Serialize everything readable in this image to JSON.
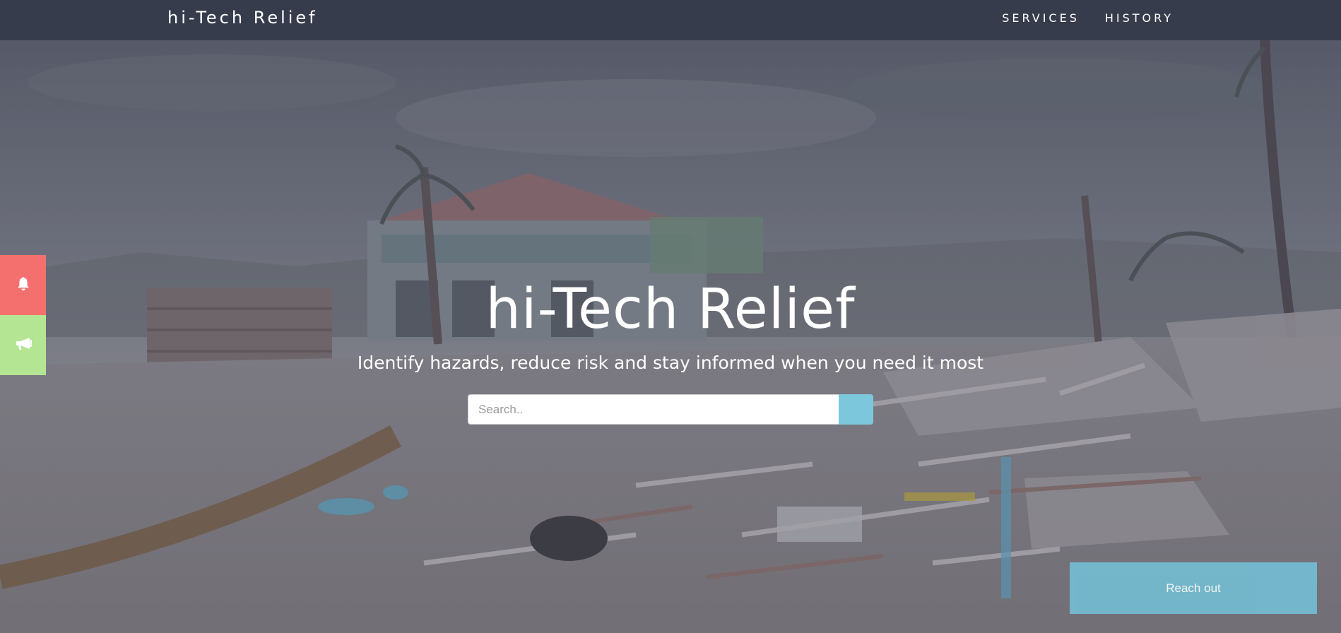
{
  "navbar": {
    "brand": "hi-Tech Relief",
    "links": [
      {
        "label": "SERVICES"
      },
      {
        "label": "HISTORY"
      }
    ],
    "background": "#373c4c"
  },
  "hero": {
    "title": "hi-Tech Relief",
    "subtitle": "Identify hazards, reduce risk and stay informed when you need it most",
    "search": {
      "placeholder": "Search..",
      "value": "",
      "button_icon": "search-icon"
    }
  },
  "side_buttons": [
    {
      "icon": "bell-icon",
      "color": "#f3706e"
    },
    {
      "icon": "megaphone-icon",
      "color": "#b3e593"
    }
  ],
  "reach_out": {
    "label": "Reach out",
    "color": "#74bcd2"
  },
  "colors": {
    "accent": "#7cc7dc",
    "alert": "#f3706e",
    "announce": "#b3e593"
  }
}
